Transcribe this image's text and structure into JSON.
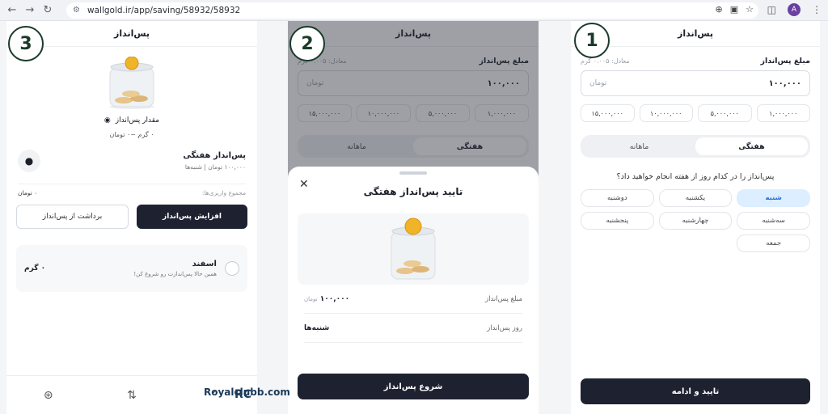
{
  "browser": {
    "url": "wallgold.ir/app/saving/58932/58932",
    "avatar_letter": "A"
  },
  "steps": {
    "one": "1",
    "two": "2",
    "three": "3"
  },
  "header_title": "پس‌انداز",
  "panel1": {
    "amount_label": "مبلغ پس‌انداز",
    "equivalent": "معادل: ۰.۰۰۵ گرم",
    "amount_value": "۱۰۰,۰۰۰",
    "unit": "تومان",
    "chips": [
      "۱,۰۰۰,۰۰۰",
      "۵,۰۰۰,۰۰۰",
      "۱۰,۰۰۰,۰۰۰",
      "۱۵,۰۰۰,۰۰۰"
    ],
    "tab_weekly": "هفتگی",
    "tab_monthly": "ماهانه",
    "question": "پس‌انداز را در کدام روز از هفته انجام خواهید داد؟",
    "days": [
      "شنبه",
      "یکشنبه",
      "دوشنبه",
      "سه‌شنبه",
      "چهارشنبه",
      "پنجشنبه",
      "جمعه"
    ],
    "confirm": "تایید و ادامه"
  },
  "panel2": {
    "amount_label": "مبلغ پس‌انداز",
    "equivalent": "معادل: ۰.۰۰۵ گرم",
    "amount_value": "۱۰۰,۰۰۰",
    "unit": "تومان",
    "chips": [
      "۱,۰۰۰,۰۰۰",
      "۵,۰۰۰,۰۰۰",
      "۱۰,۰۰۰,۰۰۰",
      "۱۵,۰۰۰,۰۰۰"
    ],
    "tab_weekly": "هفتگی",
    "tab_monthly": "ماهانه",
    "sheet_title": "تایید پس‌انداز هفتگی",
    "row1_label": "مبلغ پس‌انداز",
    "row1_value": "۱۰۰,۰۰۰",
    "row1_unit": "تومان",
    "row2_label": "روز پس‌انداز",
    "row2_value": "شنبه‌ها",
    "start": "شروع پس‌انداز"
  },
  "panel3": {
    "amount_label": "مقدار پس‌انداز",
    "amount_value": "۰ گرم  ~۰ تومان",
    "weekly_title": "پس‌انداز هفتگی",
    "weekly_sub": "۱۰۰,۰۰۰ تومان | شنبه‌ها",
    "sum_label": "مجموع واریزی‌ها:",
    "sum_value": "۰ تومان",
    "increase": "افزایش پس‌انداز",
    "withdraw": "برداشت از پس‌انداز",
    "month": "اسفند",
    "month_sub": "همین حالا پس‌اندازت رو شروع کن!",
    "month_value": "۰ گرم"
  },
  "watermark": "Royalclubb.com",
  "watermark_logo": "RC"
}
